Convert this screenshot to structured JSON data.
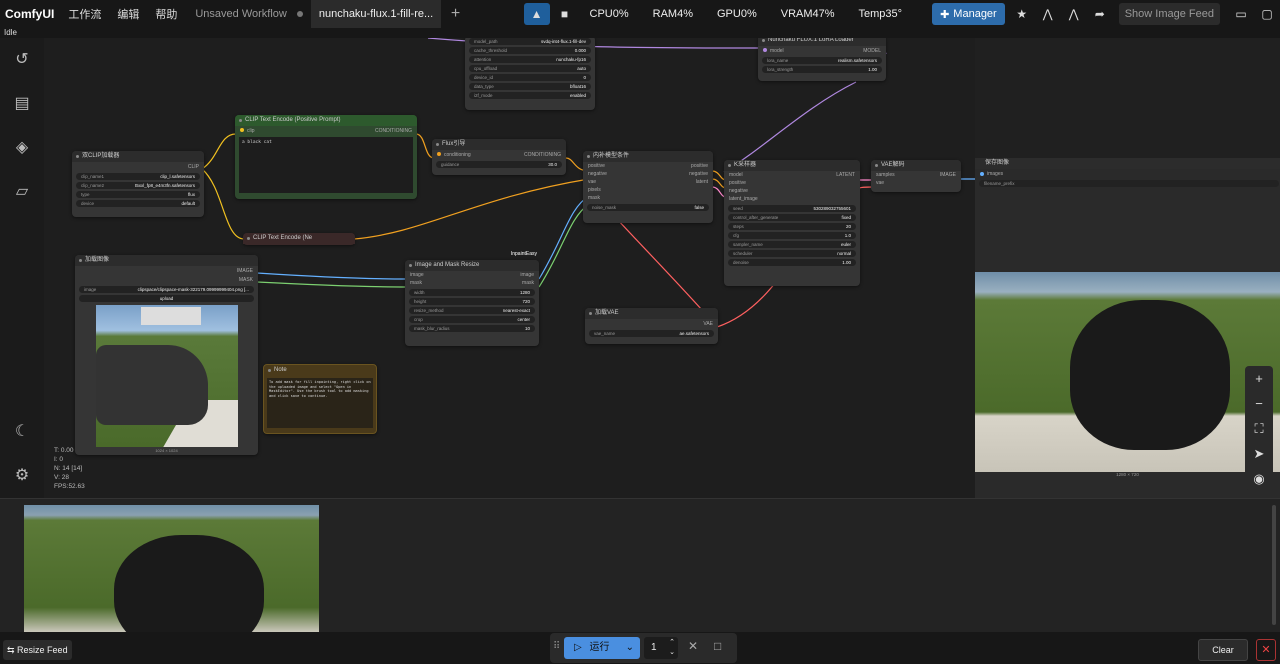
{
  "app": {
    "logo": "ComfyUI",
    "menu": [
      "工作流",
      "编辑",
      "帮助"
    ]
  },
  "tabs": [
    {
      "label": "Unsaved Workflow"
    },
    {
      "label": "nunchaku-flux.1-fill-re..."
    }
  ],
  "stats": {
    "cpu": "CPU0%",
    "ram": "RAM4%",
    "gpu": "GPU0%",
    "vram": "VRAM47%",
    "temp": "Temp35°"
  },
  "toolbar": {
    "manager": "Manager",
    "show_feed": "Show Image Feed"
  },
  "status": "Idle",
  "canvas_info": {
    "t": "T: 0.00",
    "i": "I: 0",
    "n": "N: 14 [14]",
    "v": "V: 28",
    "fps": "FPS:52.63"
  },
  "nodes": {
    "dit_loader": {
      "fields": [
        [
          "model_path",
          "svdq-int4-flux.1-fill-dev"
        ],
        [
          "cache_threshold",
          "0.000"
        ],
        [
          "attention",
          "nunchaku-fp16"
        ],
        [
          "cpu_offload",
          "auto"
        ],
        [
          "device_id",
          "0"
        ],
        [
          "data_type",
          "bfloat16"
        ],
        [
          "i2f_mode",
          "enabled"
        ]
      ]
    },
    "lora_loader": {
      "title": "Nunchaku FLUX.1 LoRA Loader",
      "in": "model",
      "out": "MODEL",
      "fields": [
        [
          "lora_name",
          "realism.safetensors"
        ],
        [
          "lora_strength",
          "1.00"
        ]
      ]
    },
    "dual_clip": {
      "title": "双CLIP加载器",
      "out": "CLIP",
      "fields": [
        [
          "clip_name1",
          "clip_l.safetensors"
        ],
        [
          "clip_name2",
          "t5xxl_fp8_e4m3fn.safetensors"
        ],
        [
          "type",
          "flux"
        ],
        [
          "device",
          "default"
        ]
      ]
    },
    "clip_pos": {
      "title": "CLIP Text Encode (Positive Prompt)",
      "in": "clip",
      "out": "CONDITIONING",
      "text": "a black cat"
    },
    "flux_guide": {
      "title": "Flux引导",
      "in": "conditioning",
      "out": "CONDITIONING",
      "fields": [
        [
          "guidance",
          "30.0"
        ]
      ]
    },
    "clip_neg": {
      "title": "CLIP Text Encode (Ne"
    },
    "inpaint_cond": {
      "title": "内补模型条件",
      "ins": [
        "positive",
        "negative",
        "vae",
        "pixels",
        "mask"
      ],
      "outs": [
        "positive",
        "negative",
        "latent"
      ],
      "fields": [
        [
          "noise_mask",
          "false"
        ]
      ]
    },
    "ksampler": {
      "title": "K采样器",
      "ins": [
        "model",
        "positive",
        "negative",
        "latent_image"
      ],
      "out": "LATENT",
      "fields": [
        [
          "seed",
          "530289032755601"
        ],
        [
          "control_after_generate",
          "fixed"
        ],
        [
          "steps",
          "20"
        ],
        [
          "cfg",
          "1.0"
        ],
        [
          "sampler_name",
          "euler"
        ],
        [
          "scheduler",
          "normal"
        ],
        [
          "denoise",
          "1.00"
        ]
      ]
    },
    "vae_decode": {
      "title": "VAE解码",
      "ins": [
        "samples",
        "vae"
      ],
      "out": "IMAGE"
    },
    "save_image": {
      "title": "保存图像",
      "in": "images",
      "fields": [
        [
          "filename_prefix",
          "filename_prefix"
        ]
      ],
      "size": "1280 × 720"
    },
    "load_image": {
      "title": "加载图像",
      "outs": [
        "IMAGE",
        "MASK"
      ],
      "fields": [
        [
          "image",
          "clipspace/clipspace-mask-322179.09999999404.png [..."
        ]
      ],
      "upload": "upload",
      "size": "1024 × 1024"
    },
    "resize": {
      "title": "Image and Mask Resize",
      "badge": "InpaintEasy",
      "ins": [
        "image",
        "mask"
      ],
      "outs": [
        "image",
        "mask"
      ],
      "fields": [
        [
          "width",
          "1280"
        ],
        [
          "height",
          "720"
        ],
        [
          "resize_method",
          "nearest-exact"
        ],
        [
          "crop",
          "center"
        ],
        [
          "mask_blur_radius",
          "10"
        ]
      ]
    },
    "vae_loader": {
      "title": "加载VAE",
      "out": "VAE",
      "fields": [
        [
          "vae_name",
          "ae.safetensors"
        ]
      ]
    },
    "note": {
      "title": "Note",
      "text": "To add mask for fill inpainting, right click on the uploaded image and select \"Open in MaskEditor\". Use the brush tool to add masking and click save to continue."
    }
  },
  "bottom": {
    "resize_feed": "Resize Feed",
    "run": "运行",
    "count": "1",
    "clear": "Clear"
  }
}
